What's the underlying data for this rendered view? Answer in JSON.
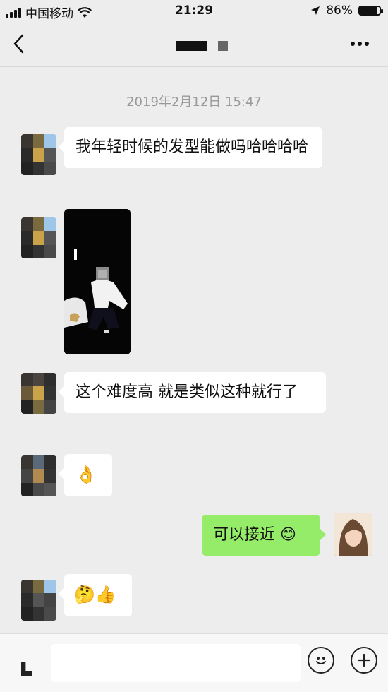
{
  "status_bar": {
    "carrier": "中国移动",
    "time": "21:29",
    "battery": "86%",
    "battery_level": 0.86
  },
  "nav": {
    "back_icon": "chevron-left-icon",
    "more_icon": "more-dots-icon"
  },
  "chat": {
    "timestamp": "2019年2月12日 15:47",
    "messages": [
      {
        "from": "other",
        "type": "text",
        "text": "我年轻时候的发型能做吗哈哈哈哈"
      },
      {
        "from": "other",
        "type": "video"
      },
      {
        "from": "other",
        "type": "text",
        "text": "这个难度高 就是类似这种就行了"
      },
      {
        "from": "other",
        "type": "emoji",
        "text": "👌"
      },
      {
        "from": "me",
        "type": "text",
        "text": "可以接近",
        "emoji": "😊"
      },
      {
        "from": "other",
        "type": "emoji",
        "text": "🤔👍"
      }
    ]
  },
  "input_bar": {
    "voice_icon": "voice-icon",
    "emoji_icon": "emoji-icon",
    "add_icon": "add-icon"
  }
}
